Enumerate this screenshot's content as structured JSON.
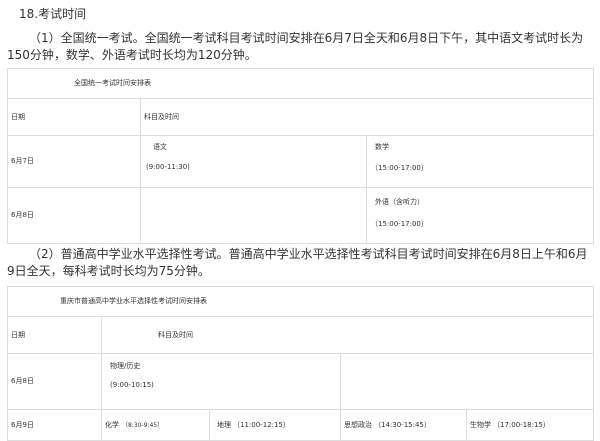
{
  "heading": "18.考试时间",
  "para1": "（1）全国统一考试。全国统一考试科目考试时间安排在6月7日全天和6月8日下午，其中语文考试时长为150分钟，数学、外语考试时长均为120分钟。",
  "table1": {
    "caption": "全国统一考试时间安排表",
    "col_date": "日期",
    "col_subject": "科目及时间",
    "row1": {
      "date": "6月7日",
      "subject_a": "语文",
      "time_a": "(9:00-11:30)",
      "subject_b": "数学",
      "time_b": "（15:00-17:00）"
    },
    "row2": {
      "date": "6月8日",
      "subject_b": "外语（含听力）",
      "time_b": "（15:00-17:00）"
    }
  },
  "para2": "（2）普通高中学业水平选择性考试。普通高中学业水平选择性考试科目考试时间安排在6月8日上午和6月9日全天，每科考试时长均为75分钟。",
  "table2": {
    "caption": "重庆市普通高中学业水平选择性考试时间安排表",
    "col_date": "日期",
    "col_subject": "科目及时间",
    "row1": {
      "date": "6月8日",
      "subject": "物理/历史",
      "time": "(9:00-10:15)"
    },
    "row2": {
      "date": "6月9日",
      "c1_subject": "化学",
      "c1_time": "（8:30-9:45）",
      "c2_subject": "地理",
      "c2_time": "（11:00-12:15）",
      "c3_subject": "思想政治",
      "c3_time": "（14:30-15:45）",
      "c4_subject": "生物学",
      "c4_time": "（17:00-18:15）"
    }
  }
}
